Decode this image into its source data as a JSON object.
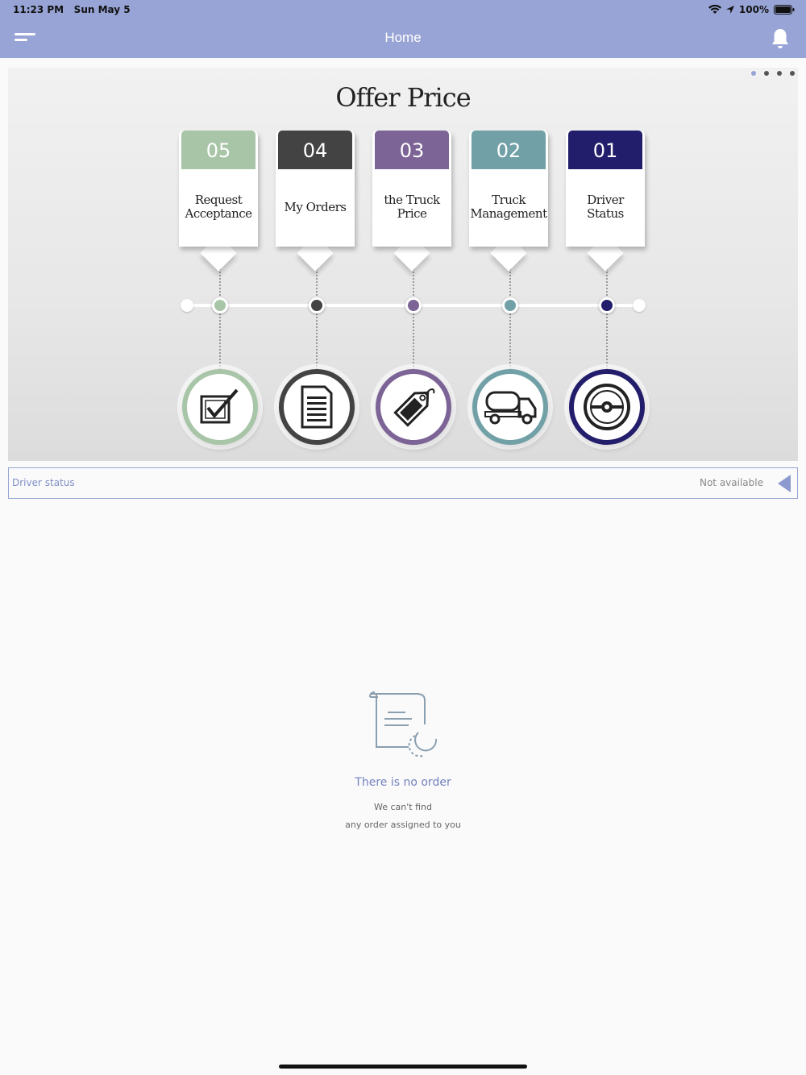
{
  "status_bar": {
    "time": "11:23 PM",
    "date": "Sun May 5",
    "battery": "100%"
  },
  "nav": {
    "title": "Home",
    "menu_icon": "hamburger-icon",
    "bell_icon": "bell-icon"
  },
  "banner": {
    "title": "Offer Price",
    "page_indicator": {
      "count": 4,
      "active_index": 0
    },
    "steps": [
      {
        "number": "05",
        "label": "Request Acceptance",
        "color": "#a8c5a7",
        "icon": "checkbox-icon"
      },
      {
        "number": "04",
        "label": "My Orders",
        "color": "#434343",
        "icon": "document-icon"
      },
      {
        "number": "03",
        "label": "the Truck Price",
        "color": "#7c6496",
        "icon": "price-tag-icon"
      },
      {
        "number": "02",
        "label": "Truck Management",
        "color": "#71a1a7",
        "icon": "truck-icon"
      },
      {
        "number": "01",
        "label": "Driver Status",
        "color": "#231e6b",
        "icon": "steering-wheel-icon"
      }
    ]
  },
  "driver_status": {
    "label": "Driver status",
    "value": "Not available"
  },
  "empty_state": {
    "title": "There is no order",
    "line1": "We can't find",
    "line2": "any order assigned to you"
  }
}
